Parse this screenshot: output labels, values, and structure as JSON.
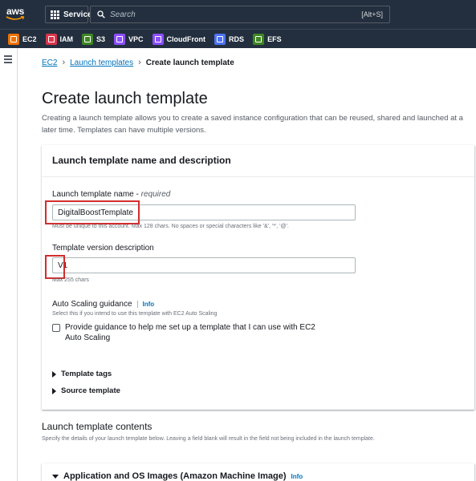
{
  "topbar": {
    "logo_text": "aws",
    "services_label": "Services",
    "search_placeholder": "Search",
    "search_shortcut": "[Alt+S]"
  },
  "favorites": [
    {
      "label": "EC2",
      "icon": "ec2-icon",
      "color": "#ed7100"
    },
    {
      "label": "IAM",
      "icon": "iam-icon",
      "color": "#dd344c"
    },
    {
      "label": "S3",
      "icon": "s3-icon",
      "color": "#3f8624"
    },
    {
      "label": "VPC",
      "icon": "vpc-icon",
      "color": "#8c4fff"
    },
    {
      "label": "CloudFront",
      "icon": "cloudfront-icon",
      "color": "#8c4fff"
    },
    {
      "label": "RDS",
      "icon": "rds-icon",
      "color": "#4d72f3"
    },
    {
      "label": "EFS",
      "icon": "efs-icon",
      "color": "#3f8624"
    }
  ],
  "breadcrumb": {
    "items": [
      "EC2",
      "Launch templates"
    ],
    "current": "Create launch template"
  },
  "page": {
    "title": "Create launch template",
    "description": "Creating a launch template allows you to create a saved instance configuration that can be reused, shared and launched at a later time. Templates can have multiple versions."
  },
  "name_section": {
    "title": "Launch template name and description",
    "name_label": "Launch template name",
    "name_required": "required",
    "name_value": "DigitalBoostTemplate",
    "name_hint": "Must be unique to this account. Max 128 chars. No spaces or special characters like '&', '*', '@'.",
    "version_label": "Template version description",
    "version_value": "V1",
    "version_hint": "Max 255 chars",
    "asg_label": "Auto Scaling guidance",
    "asg_info": "Info",
    "asg_hint": "Select this if you intend to use this template with EC2 Auto Scaling",
    "asg_checkbox_label": "Provide guidance to help me set up a template that I can use with EC2 Auto Scaling",
    "asg_checked": false,
    "template_tags": "Template tags",
    "source_template": "Source template"
  },
  "contents": {
    "title": "Launch template contents",
    "description": "Specify the details of your launch template below. Leaving a field blank will result in the field not being included in the launch template."
  },
  "ami_section": {
    "title": "Application and OS Images (Amazon Machine Image)",
    "info": "Info"
  },
  "colors": {
    "nav_bg": "#232f3e",
    "link": "#0073bb",
    "highlight": "#d42d2d"
  }
}
